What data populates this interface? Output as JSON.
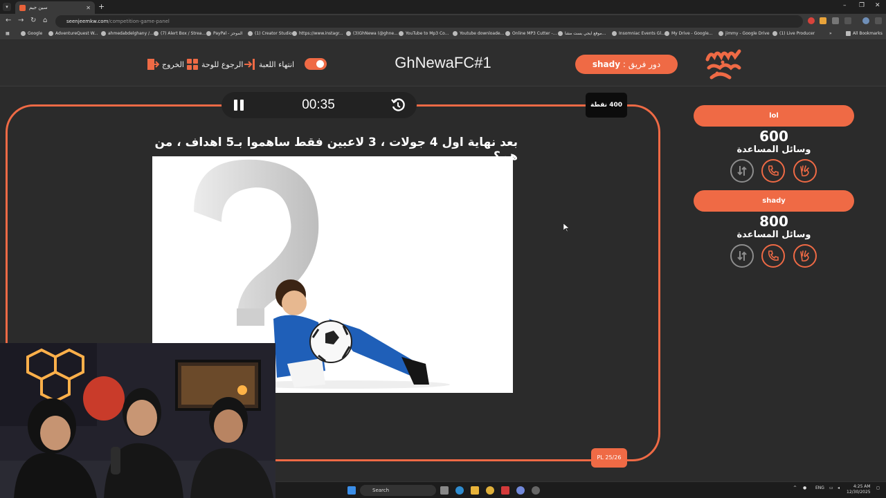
{
  "browser": {
    "tab_title": "سين جيم",
    "url_host": "seenjeemkw.com",
    "url_path": "/competition-game-panel",
    "bookmarks": [
      "Google",
      "AdventureQuest W...",
      "ahmedabdelghany /...",
      "(7) Alert Box / Strea...",
      "PayPal - الموجز",
      "(1) Creator Studio",
      "https://www.instagr...",
      "(3)GhNewa (@ghne...",
      "YouTube to Mp3 Co...",
      "Youtube downloade...",
      "Online MP3 Cutter -...",
      "موقع ايجي بست مشا...",
      "Insomniac Events Gl...",
      "My Drive - Google...",
      "jimmy - Google Drive",
      "(1) Live Producer"
    ],
    "all_bookmarks": "All Bookmarks"
  },
  "header": {
    "exit_label": "الخروج",
    "back_to_board_label": "الرجوع للوحة",
    "end_game_label": "انتهاء اللعبة",
    "game_title": "GhNewaFC#1",
    "turn_prefix": "دور فريق : ",
    "turn_team": "shady"
  },
  "timer": {
    "time": "00:35"
  },
  "question": {
    "points": "400 نقطة",
    "text": "بعد نهاية اول 4 جولات ، 3 لاعبين فقط ساهموا بـ5 اهداف ، من هم؟",
    "progress": "PL 25/26"
  },
  "teams": [
    {
      "name": "lol",
      "score": "600",
      "aids_label": "وسائل المساعدة"
    },
    {
      "name": "shady",
      "score": "800",
      "aids_label": "وسائل المساعدة"
    }
  ],
  "taskbar": {
    "search_label": "Search",
    "language": "ENG",
    "time": "4:25 AM",
    "date": "12/30/2025"
  },
  "colors": {
    "accent": "#ef6a45",
    "background": "#2b2b2b"
  }
}
